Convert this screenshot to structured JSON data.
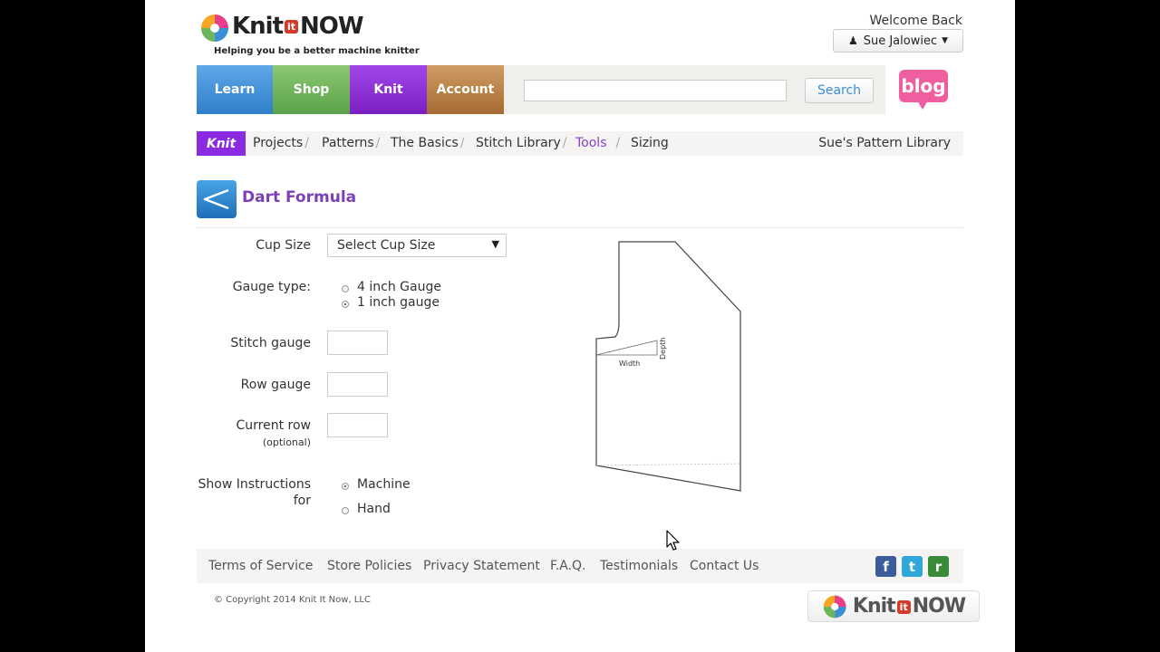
{
  "header": {
    "logo_text_left": "Knit",
    "logo_text_it": "it",
    "logo_text_right": "NOW",
    "tagline": "Helping you be a better machine knitter",
    "welcome": "Welcome Back",
    "user_name": "Sue Jalowiec"
  },
  "nav": {
    "learn": "Learn",
    "shop": "Shop",
    "knit": "Knit",
    "account": "Account",
    "search_value": "",
    "search_button": "Search",
    "blog": "blog"
  },
  "subnav": {
    "section": "Knit",
    "items": [
      "Projects",
      "Patterns",
      "The Basics",
      "Stitch Library",
      "Tools",
      "Sizing"
    ],
    "separator": "/",
    "right_link": "Sue's Pattern Library"
  },
  "page": {
    "title": "Dart Formula"
  },
  "form": {
    "cup_size_label": "Cup Size",
    "cup_size_value": "Select Cup Size",
    "gauge_type_label": "Gauge type:",
    "gauge_options": [
      "4 inch Gauge",
      "1 inch gauge"
    ],
    "gauge_selected": 1,
    "stitch_gauge_label": "Stitch gauge",
    "row_gauge_label": "Row gauge",
    "current_row_label": "Current row",
    "current_row_hint": "(optional)",
    "show_instructions_label_1": "Show Instructions",
    "show_instructions_label_2": "for",
    "instruction_options": [
      "Machine",
      "Hand"
    ],
    "instruction_selected": 0
  },
  "diagram": {
    "depth_label": "Depth",
    "width_label": "Width"
  },
  "footer": {
    "links": [
      "Terms of Service",
      "Store Policies",
      "Privacy Statement",
      "F.A.Q.",
      "Testimonials",
      "Contact Us"
    ],
    "social": [
      "facebook-icon",
      "twitter-icon",
      "ravelry-icon"
    ],
    "social_letters": [
      "f",
      "t",
      "r"
    ],
    "copyright": "© Copyright 2014 Knit It Now, LLC"
  },
  "colors": {
    "learn": "#3f8fd9",
    "shop": "#6db55a",
    "knit": "#8a2be2",
    "account": "#b97d42",
    "blog": "#ef5fa0",
    "title": "#7c3fb7"
  }
}
